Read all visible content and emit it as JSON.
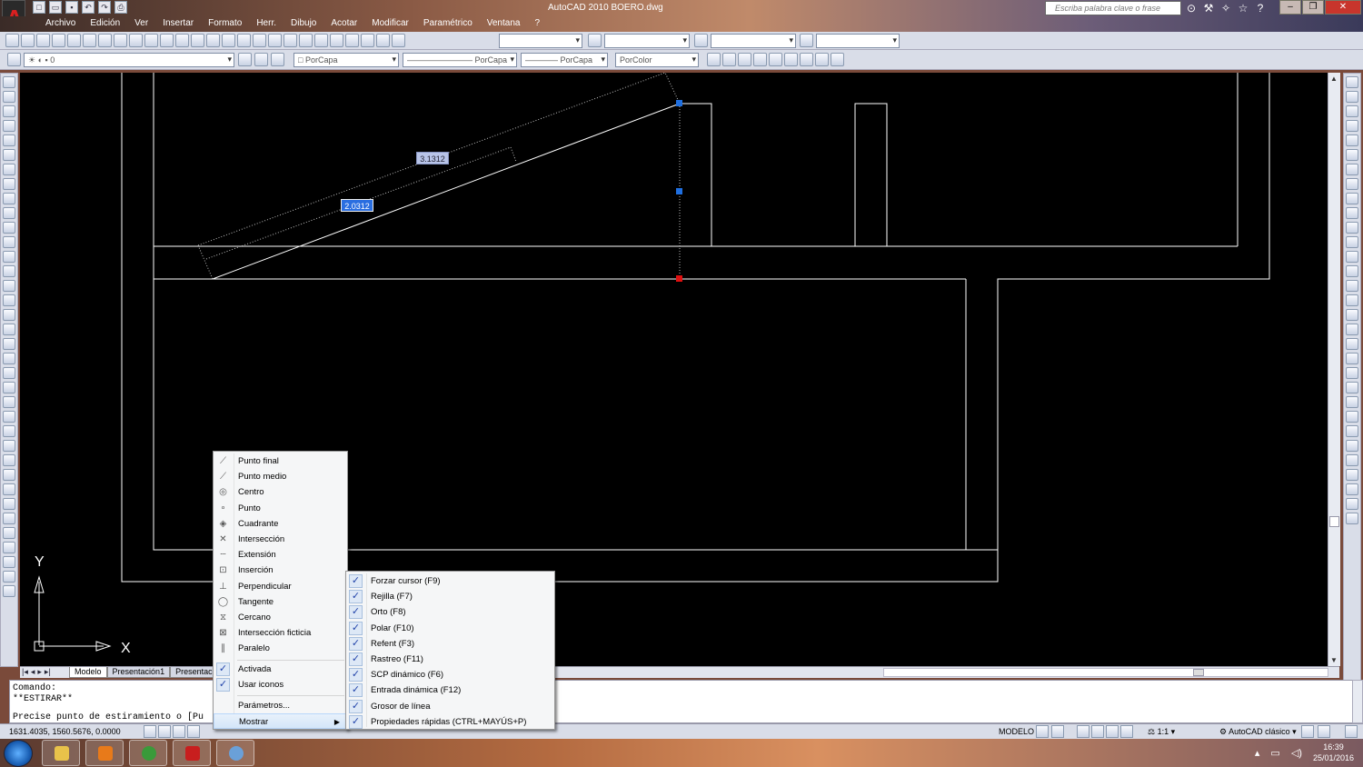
{
  "window": {
    "title": "AutoCAD 2010     BOERO.dwg",
    "search_placeholder": "Escriba palabra clave o frase"
  },
  "menubar": [
    "Archivo",
    "Edición",
    "Ver",
    "Insertar",
    "Formato",
    "Herr.",
    "Dibujo",
    "Acotar",
    "Modificar",
    "Paramétrico",
    "Ventana",
    "?"
  ],
  "toolbar": {
    "layer_value": "0",
    "color_value": "PorCapa",
    "linetype_value": "PorCapa",
    "lineweight_value": "PorCapa",
    "plotstyle_value": "PorColor"
  },
  "canvas": {
    "dim_value_1": "3.1312",
    "dim_value_2": "2.0312",
    "ucs_y": "Y",
    "ucs_x": "X"
  },
  "tabs": {
    "items": [
      "Modelo",
      "Presentación1",
      "Presentación"
    ],
    "active": "Modelo"
  },
  "command": {
    "lines": [
      "Comando:",
      "**ESTIRAR**",
      "",
      "Precise punto de estiramiento o [Pu"
    ]
  },
  "status": {
    "coords": "1631.4035, 1560.5676, 0.0000",
    "model": "MODELO",
    "scale": "1:1",
    "workspace": "AutoCAD clásico"
  },
  "taskbar": {
    "time": "16:39",
    "date": "25/01/2016"
  },
  "snap_menu": {
    "items": [
      {
        "label": "Punto final",
        "icon": "endpoint-icon",
        "glyph": "⟋"
      },
      {
        "label": "Punto medio",
        "icon": "midpoint-icon",
        "glyph": "⟋"
      },
      {
        "label": "Centro",
        "icon": "center-icon",
        "glyph": "◎"
      },
      {
        "label": "Punto",
        "icon": "node-icon",
        "glyph": "∘"
      },
      {
        "label": "Cuadrante",
        "icon": "quadrant-icon",
        "glyph": "◈"
      },
      {
        "label": "Intersección",
        "icon": "intersection-icon",
        "glyph": "✕"
      },
      {
        "label": "Extensión",
        "icon": "extension-icon",
        "glyph": "┄"
      },
      {
        "label": "Inserción",
        "icon": "insertion-icon",
        "glyph": "⊡"
      },
      {
        "label": "Perpendicular",
        "icon": "perpendicular-icon",
        "glyph": "⊥"
      },
      {
        "label": "Tangente",
        "icon": "tangent-icon",
        "glyph": "◯"
      },
      {
        "label": "Cercano",
        "icon": "nearest-icon",
        "glyph": "⧖"
      },
      {
        "label": "Intersección ficticia",
        "icon": "apparent-intersection-icon",
        "glyph": "⊠"
      },
      {
        "label": "Paralelo",
        "icon": "parallel-icon",
        "glyph": "∥"
      }
    ],
    "activada": "Activada",
    "usar_iconos": "Usar iconos",
    "parametros": "Parámetros...",
    "mostrar": "Mostrar"
  },
  "mostrar_menu": {
    "items": [
      "Forzar cursor (F9)",
      "Rejilla (F7)",
      "Orto (F8)",
      "Polar (F10)",
      "Refent (F3)",
      "Rastreo (F11)",
      "SCP dinámico (F6)",
      "Entrada dinámica (F12)",
      "Grosor de línea",
      "Propiedades rápidas (CTRL+MAYÚS+P)"
    ]
  },
  "colors": {
    "canvas_bg": "#000000",
    "geometry": "#ffffff",
    "grip_blue": "#1f6fe0",
    "grip_red": "#e01010",
    "menu_bg": "#f5f6f7"
  }
}
